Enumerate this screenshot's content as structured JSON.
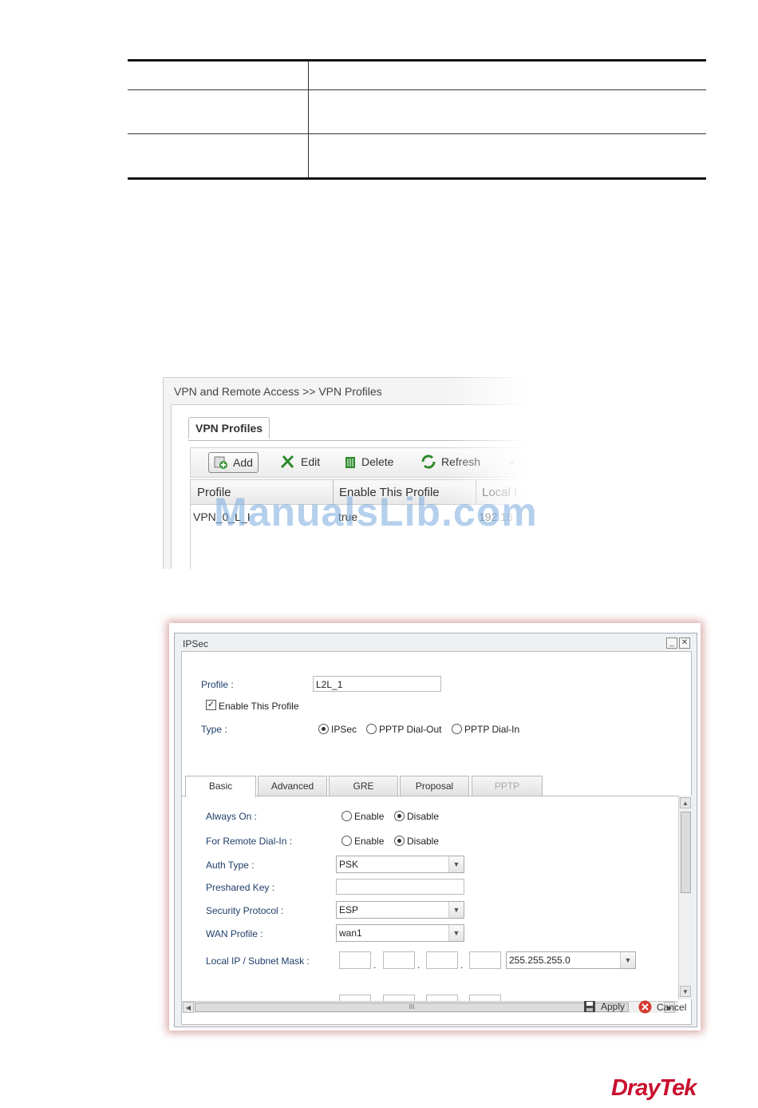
{
  "shot1": {
    "breadcrumb": "VPN and Remote Access >> VPN Profiles",
    "tab": "VPN Profiles",
    "toolbar": {
      "add": "Add",
      "edit": "Edit",
      "delete": "Delete",
      "refresh": "Refresh"
    },
    "columns": [
      "Profile",
      "Enable This Profile",
      "Local I"
    ],
    "row": {
      "profile": "VPN_0_L_I",
      "enable": "true",
      "local": "192.16"
    }
  },
  "watermark": "ManualsLib.com",
  "dialog": {
    "title": "IPSec",
    "profile_label": "Profile :",
    "profile_value": "L2L_1",
    "enable_label": "Enable This Profile",
    "enable_checked": true,
    "type_label": "Type :",
    "type_options": [
      "IPSec",
      "PPTP Dial-Out",
      "PPTP Dial-In"
    ],
    "type_selected": "IPSec",
    "tabs": [
      "Basic",
      "Advanced",
      "GRE",
      "Proposal",
      "PPTP"
    ],
    "active_tab": "Basic",
    "always_on_label": "Always On :",
    "remote_dialin_label": "For Remote Dial-In :",
    "enable_opt": "Enable",
    "disable_opt": "Disable",
    "always_on_value": "Disable",
    "remote_dialin_value": "Disable",
    "auth_type_label": "Auth Type :",
    "auth_type_value": "PSK",
    "preshared_label": "Preshared Key :",
    "preshared_value": "",
    "security_label": "Security Protocol :",
    "security_value": "ESP",
    "wan_label": "WAN Profile :",
    "wan_value": "wan1",
    "local_ip_label": "Local IP / Subnet Mask :",
    "subnet_value": "255.255.255.0",
    "hscroll_grip": "III",
    "apply": "Apply",
    "cancel": "Cancel"
  },
  "brand": "DrayTek",
  "colors": {
    "brand": "#c8102e",
    "label": "#1f3f6a",
    "watermark": "#78aadc"
  }
}
